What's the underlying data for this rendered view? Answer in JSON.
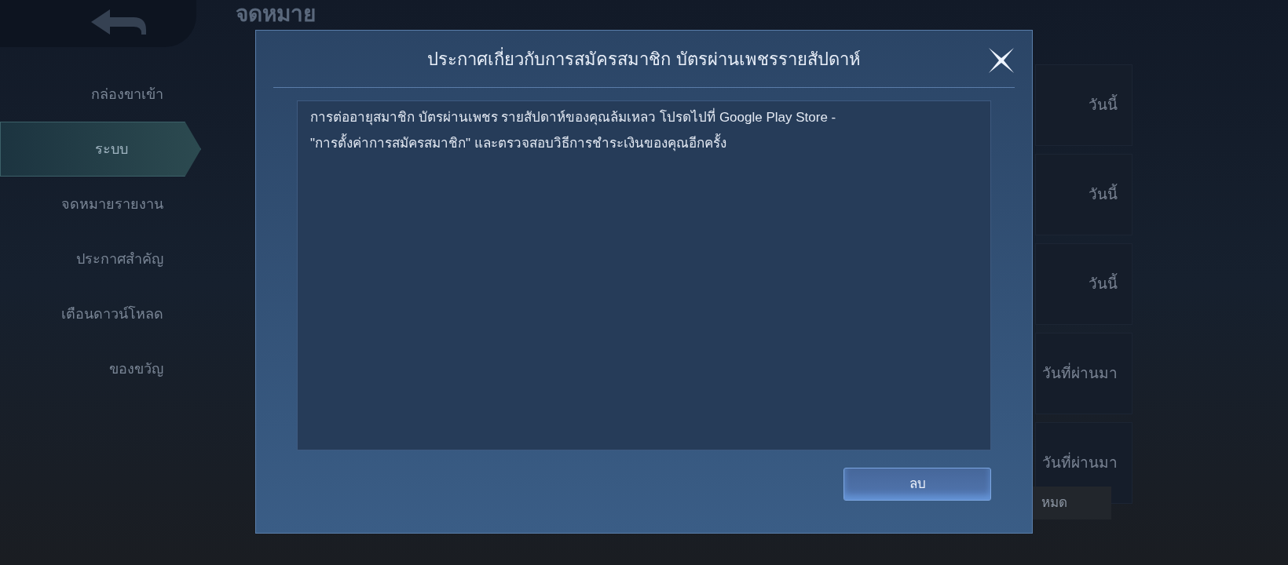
{
  "header": {
    "title": "จดหมาย"
  },
  "sidebar": {
    "items": [
      {
        "label": "กล่องขาเข้า",
        "selected": false
      },
      {
        "label": "ระบบ",
        "selected": true
      },
      {
        "label": "จดหมายรายงาน",
        "selected": false
      },
      {
        "label": "ประกาศสำคัญ",
        "selected": false
      },
      {
        "label": "เตือนดาวน์โหลด",
        "selected": false
      },
      {
        "label": "ของขวัญ",
        "selected": false
      }
    ]
  },
  "mail_list": {
    "items": [
      {
        "date": "วันนี้"
      },
      {
        "date": "วันนี้"
      },
      {
        "date": "วันนี้"
      },
      {
        "date": "วันที่ผ่านมา"
      },
      {
        "date": "วันที่ผ่านมา"
      }
    ],
    "bottom_button": "หมด"
  },
  "dialog": {
    "title": "ประกาศเกี่ยวกับการสมัครสมาชิก บัตรผ่านเพชรรายสัปดาห์",
    "lines": [
      "การต่ออายุสมาชิก บัตรผ่านเพชร รายสัปดาห์ของคุณล้มเหลว โปรดไปที่ Google Play Store -",
      "\"การตั้งค่าการสมัครสมาชิก\" และตรวจสอบวิธีการชำระเงินของคุณอีกครั้ง"
    ],
    "button": "ลบ"
  }
}
